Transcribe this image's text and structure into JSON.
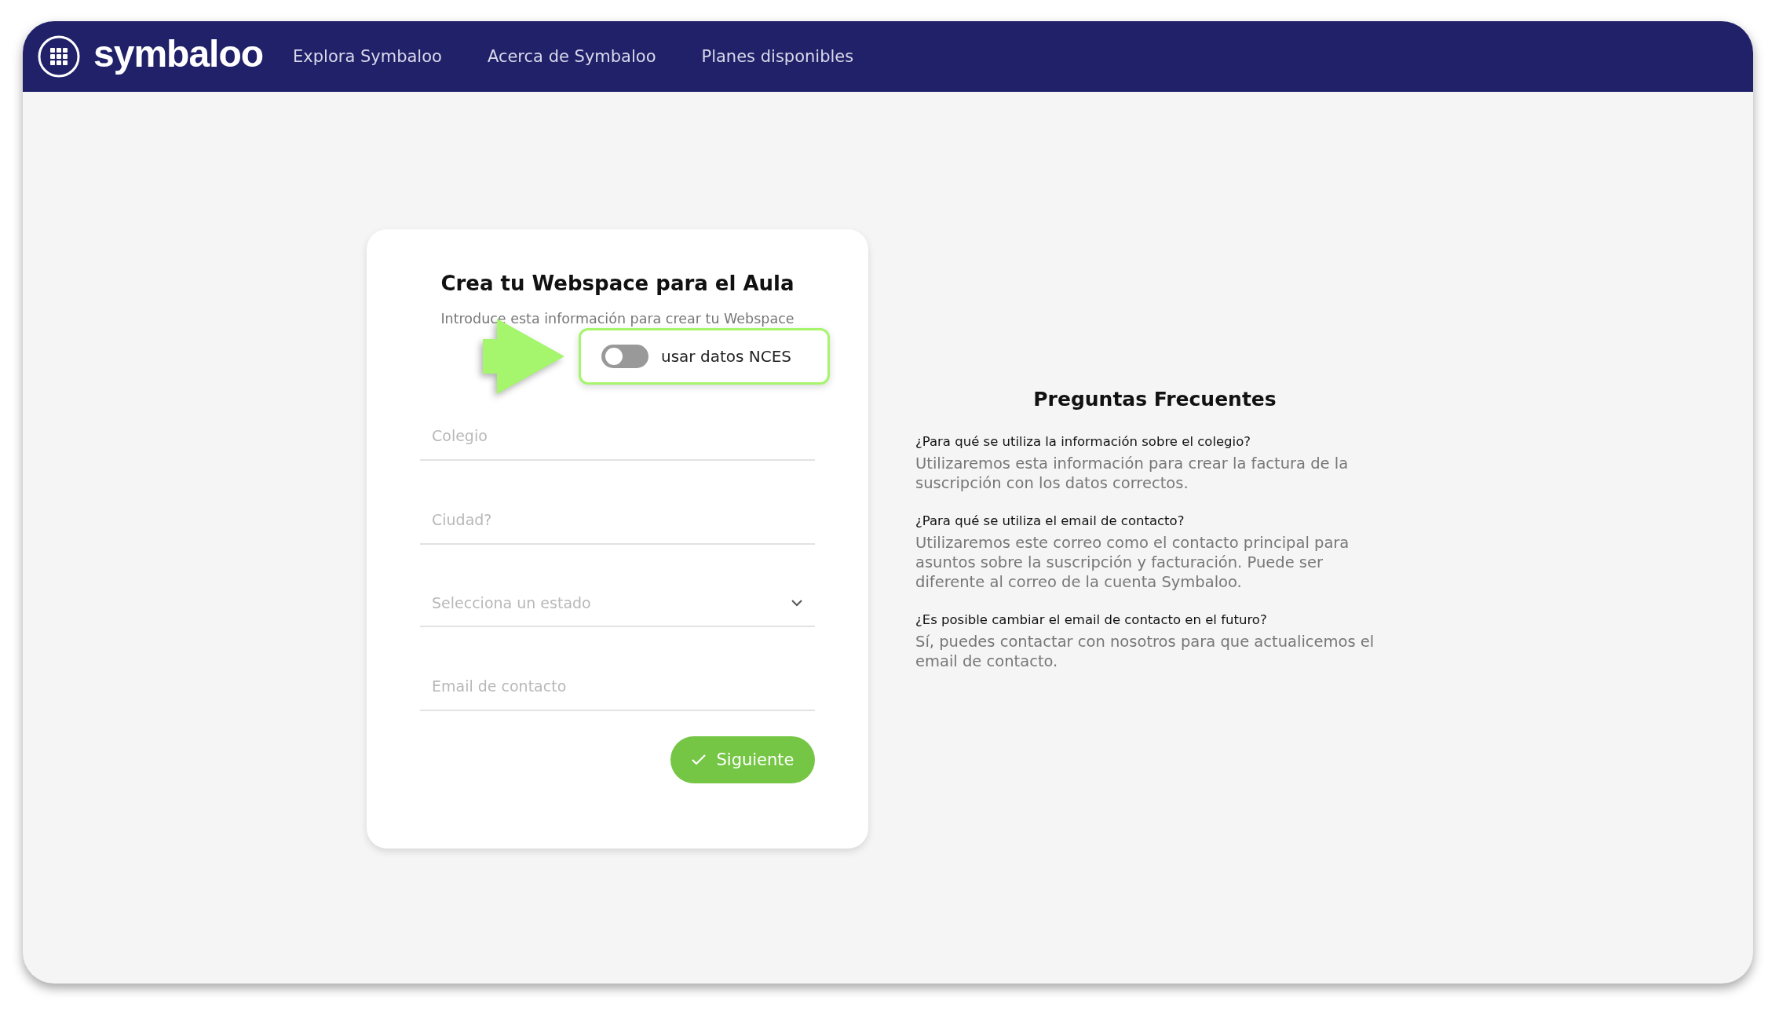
{
  "header": {
    "logo": "symbaloo",
    "nav": [
      "Explora Symbaloo",
      "Acerca de Symbaloo",
      "Planes disponibles"
    ]
  },
  "form": {
    "title": "Crea tu Webspace para el Aula",
    "subtitle": "Introduce esta información para crear tu Webspace",
    "toggle": {
      "label": "usar datos NCES",
      "on": false
    },
    "fields": [
      {
        "kind": "text",
        "placeholder": "Colegio"
      },
      {
        "kind": "text",
        "placeholder": "Ciudad?"
      },
      {
        "kind": "select",
        "placeholder": "Selecciona un estado"
      },
      {
        "kind": "text",
        "placeholder": "Email de contacto"
      }
    ],
    "submit": "Siguiente"
  },
  "faq": {
    "title": "Preguntas Frecuentes",
    "items": [
      {
        "question": "¿Para qué se utiliza la información sobre el colegio?",
        "answer": "Utilizaremos esta información para crear la factura de la suscripción con los datos correctos."
      },
      {
        "question": "¿Para qué se utiliza el email de contacto?",
        "answer": "Utilizaremos este correo como el contacto principal para asuntos sobre la suscripción y facturación. Puede ser diferente al correo de la cuenta Symbaloo."
      },
      {
        "question": "¿Es posible cambiar el email de contacto en el futuro?",
        "answer": "Sí, puedes contactar con nosotros para que actualicemos el email de contacto."
      }
    ]
  }
}
